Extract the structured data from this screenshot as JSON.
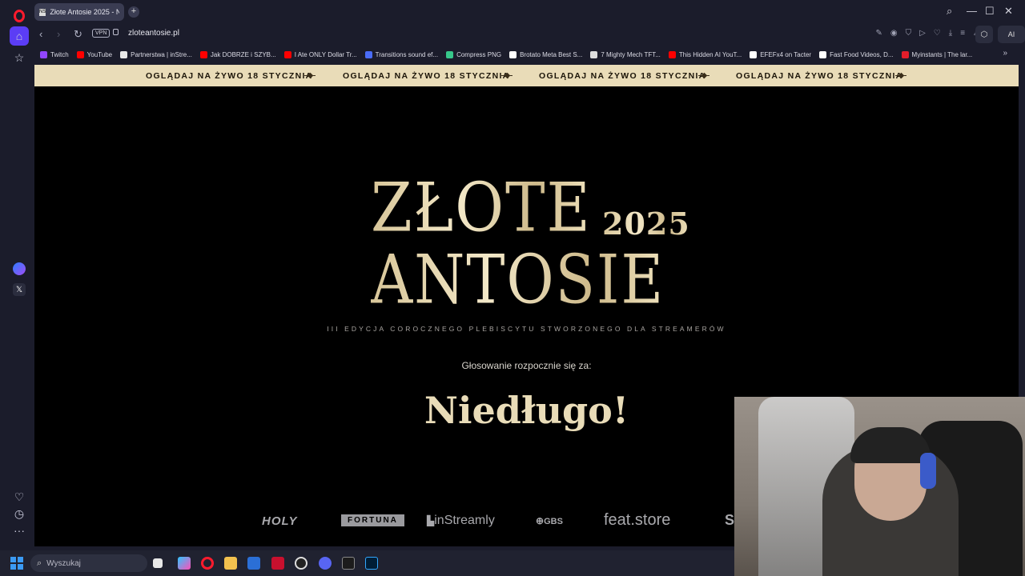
{
  "browser": {
    "tab_title": "Złote Antosie 2025 - Naj",
    "tab_favicon": "NS",
    "url": "zloteantosie.pl",
    "vpn_label": "VPN",
    "ai_label": "AI",
    "bookmarks": [
      {
        "label": "Twitch",
        "color": "#9146ff"
      },
      {
        "label": "YouTube",
        "color": "#ff0000"
      },
      {
        "label": "Partnerstwa | inStre...",
        "color": "#e8e8e8"
      },
      {
        "label": "Jak DOBRZE i SZYB...",
        "color": "#ff0000"
      },
      {
        "label": "I Ate ONLY Dollar Tr...",
        "color": "#ff0000"
      },
      {
        "label": "Transitions sound ef...",
        "color": "#4a6cf7"
      },
      {
        "label": "Compress PNG",
        "color": "#37c78a"
      },
      {
        "label": "Brotato Meta Best S...",
        "color": "#ffffff"
      },
      {
        "label": "7 Mighty Mech TFT...",
        "color": "#dddddd"
      },
      {
        "label": "This Hidden AI YouT...",
        "color": "#ff0000"
      },
      {
        "label": "EFEFx4 on Tacter",
        "color": "#ffffff"
      },
      {
        "label": "Fast Food Videos, D...",
        "color": "#ffffff"
      },
      {
        "label": "Myinstants | The lar...",
        "color": "#e11d2a"
      }
    ]
  },
  "page": {
    "ticker_text": "OGLĄDAJ NA ŻYWO 18 STYCZNIA",
    "logo": {
      "line1": "ZŁOTE",
      "line2": "ANTOSIE",
      "year": "2025"
    },
    "subtitle": "III EDYCJA COROCZNEGO PLEBISCYTU STWORZONEGO DLA STREAMERÓW",
    "vote_label": "Głosowanie rozpocznie się za:",
    "countdown": "Niedługo!",
    "sponsors": {
      "holy": "HOLY",
      "fortuna": "FORTUNA",
      "instreamly": "inStreamly",
      "gbs": "GBS",
      "featstore": "feat.store",
      "partial": "S"
    }
  },
  "taskbar": {
    "search_placeholder": "Wyszukaj"
  },
  "colors": {
    "accent_gold": "#e9dcb8",
    "page_bg": "#000000",
    "browser_bg": "#1b1c2b",
    "opera_red": "#ff1b2d",
    "sidebar_active": "#5b3df5"
  }
}
